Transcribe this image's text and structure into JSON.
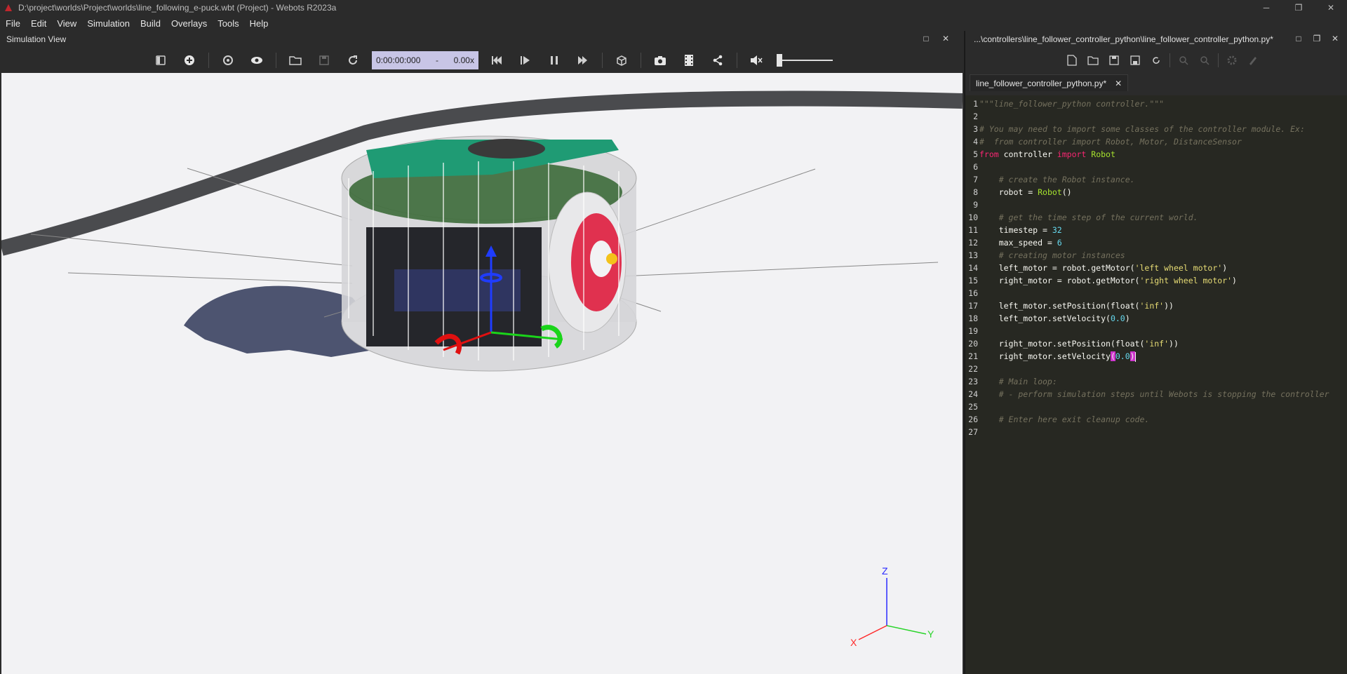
{
  "window": {
    "title": "D:\\project\\worlds\\Project\\worlds\\line_following_e-puck.wbt (Project) - Webots R2023a"
  },
  "menu": [
    {
      "label": "File"
    },
    {
      "label": "Edit"
    },
    {
      "label": "View"
    },
    {
      "label": "Simulation"
    },
    {
      "label": "Build"
    },
    {
      "label": "Overlays"
    },
    {
      "label": "Tools"
    },
    {
      "label": "Help"
    }
  ],
  "simulation_view": {
    "title": "Simulation View",
    "time": "0:00:00:000",
    "time_separator": "-",
    "speed": "0.00x",
    "axes": {
      "x": "X",
      "y": "Y",
      "z": "Z"
    }
  },
  "editor": {
    "path": "...\\controllers\\line_follower_controller_python\\line_follower_controller_python.py*",
    "tab_label": "line_follower_controller_python.py*",
    "line_numbers": [
      "1",
      "2",
      "3",
      "4",
      "5",
      "6",
      "7",
      "8",
      "9",
      "10",
      "11",
      "12",
      "13",
      "14",
      "15",
      "16",
      "17",
      "18",
      "19",
      "20",
      "21",
      "22",
      "23",
      "24",
      "25",
      "26",
      "27"
    ],
    "code": {
      "l1": "\"\"\"line_follower_python controller.\"\"\"",
      "l3": "# You may need to import some classes of the controller module. Ex:",
      "l4": "#  from controller import Robot, Motor, DistanceSensor",
      "l5_kw1": "from",
      "l5_mod": " controller ",
      "l5_kw2": "import",
      "l5_cls": " Robot",
      "l7": "    # create the Robot instance.",
      "l8_a": "    robot = ",
      "l8_cls": "Robot",
      "l8_b": "()",
      "l10": "    # get the time step of the current world.",
      "l11_a": "    timestep = ",
      "l11_num": "32",
      "l12_a": "    max_speed = ",
      "l12_num": "6",
      "l13": "    # creating motor instances",
      "l14_a": "    left_motor = robot.getMotor(",
      "l14_str": "'left wheel motor'",
      "l14_b": ")",
      "l15_a": "    right_motor = robot.getMotor(",
      "l15_str": "'right wheel motor'",
      "l15_b": ")",
      "l17_a": "    left_motor.setPosition(float(",
      "l17_str": "'inf'",
      "l17_b": "))",
      "l18_a": "    left_motor.setVelocity(",
      "l18_num": "0.0",
      "l18_b": ")",
      "l20_a": "    right_motor.setPosition(float(",
      "l20_str": "'inf'",
      "l20_b": "))",
      "l21_a": "    right_motor.setVelocity",
      "l21_open": "(",
      "l21_num": "0.0",
      "l21_close": ")",
      "l23": "    # Main loop:",
      "l24": "    # - perform simulation steps until Webots is stopping the controller",
      "l26": "    # Enter here exit cleanup code."
    }
  },
  "colors": {
    "accent_time_box": "#c8c5e6",
    "editor_bg": "#272822",
    "viewport_bg": "#f2f2f4"
  },
  "icons": {
    "app": "webots-icon",
    "toolbar": [
      "hide-scene-tree-icon",
      "add-node-icon",
      "reset-view-icon",
      "view-icon",
      "open-world-icon",
      "save-world-icon",
      "reload-world-icon",
      "reset-simulation-icon",
      "step-icon",
      "pause-icon",
      "fast-forward-icon",
      "toggle-3d-icon",
      "screenshot-icon",
      "record-movie-icon",
      "share-icon",
      "mute-icon"
    ]
  }
}
